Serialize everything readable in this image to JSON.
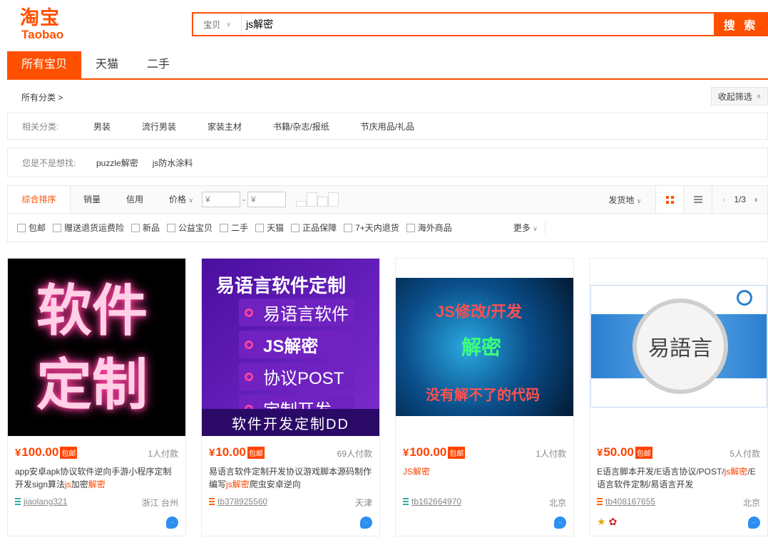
{
  "logo": {
    "cn": "淘宝",
    "en": "Taobao"
  },
  "search": {
    "scope": "宝贝",
    "query": "js解密",
    "button": "搜 索"
  },
  "tabs": [
    "所有宝贝",
    "天猫",
    "二手"
  ],
  "categories": {
    "all_label": "所有分类 >",
    "collapse_label": "收起筛选",
    "related_label": "相关分类:",
    "related": [
      "男装",
      "流行男装",
      "家装主材",
      "书籍/杂志/报纸",
      "节庆用品/礼品"
    ],
    "suggest_label": "您是不是想找:",
    "suggest": [
      "puzzle解密",
      "js防水涂料"
    ]
  },
  "sortbar": {
    "sorts": [
      "综合排序",
      "销量",
      "信用",
      "价格"
    ],
    "price_from_placeholder": "¥",
    "price_to_placeholder": "¥",
    "price_dash": "-",
    "location": "发货地",
    "page": "1/3"
  },
  "filters": [
    "包邮",
    "赠送退货运费险",
    "新品",
    "公益宝贝",
    "二手",
    "天猫",
    "正品保障",
    "7+天内退货",
    "海外商品"
  ],
  "more_label": "更多",
  "products": [
    {
      "price": "100.00",
      "yen": "¥",
      "free": "包邮",
      "sold": "1人付款",
      "title_pre": "app安卓apk协议软件逆向手游小程序定制开发sign算法",
      "hl1": "js",
      "title_mid": "加密",
      "hl2": "解密",
      "title_post": "",
      "shop": "jiaolang321",
      "location": "浙江 台州",
      "img_line1": "软件",
      "img_line2": "定制"
    },
    {
      "price": "10.00",
      "yen": "¥",
      "free": "包邮",
      "sold": "69人付款",
      "title_pre": "易语言软件定制开发协议游戏脚本源码制作编写",
      "hl1": "js解密",
      "title_mid": "爬虫安卓逆向",
      "hl2": "",
      "title_post": "",
      "shop": "tb378925560",
      "location": "天津",
      "img_head": "易语言软件定制",
      "img_items": [
        "易语言软件",
        "JS解密",
        "协议POST",
        "定制开发"
      ],
      "img_foot": "软件开发定制DD"
    },
    {
      "price": "100.00",
      "yen": "¥",
      "free": "包邮",
      "sold": "1人付款",
      "title_pre": "",
      "hl1": "JS解密",
      "title_mid": "",
      "hl2": "",
      "title_post": "",
      "shop": "tb162664970",
      "location": "北京",
      "img_line1": "JS修改/开发",
      "img_line2": "解密",
      "img_line3": "没有解不了的代码"
    },
    {
      "price": "50.00",
      "yen": "¥",
      "free": "包邮",
      "sold": "5人付款",
      "title_pre": "E语言脚本开发/E语言协议/POST/",
      "hl1": "js解密",
      "title_mid": "/E语言软件定制/易语言开发",
      "hl2": "",
      "title_post": "",
      "shop": "tb408167655",
      "location": "北京",
      "img_text": "易語言"
    }
  ],
  "colors": {
    "brand": "#ff5000",
    "price": "#ff4400"
  }
}
